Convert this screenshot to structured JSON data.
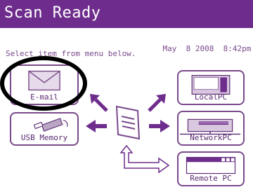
{
  "header": {
    "title": "Scan Ready"
  },
  "status": {
    "date": "May",
    "day": "8",
    "year": "2008",
    "time": "8:42pm"
  },
  "instruction": "Select item from menu below.",
  "buttons": {
    "email": "E-mail",
    "usb": "USB Memory",
    "localpc": "LocalPC",
    "networkpc": "NetworkPC",
    "remotepc": "Remote PC"
  },
  "colors": {
    "header_bg": "#6e2d8c",
    "accent": "#7a4a8c",
    "highlight_ring": "#000000"
  },
  "icons": {
    "email": "envelope-icon",
    "usb": "usb-drive-icon",
    "localpc": "computer-icon",
    "networkpc": "network-drive-icon",
    "remotepc": "remote-computer-icon",
    "center": "document-icon"
  }
}
